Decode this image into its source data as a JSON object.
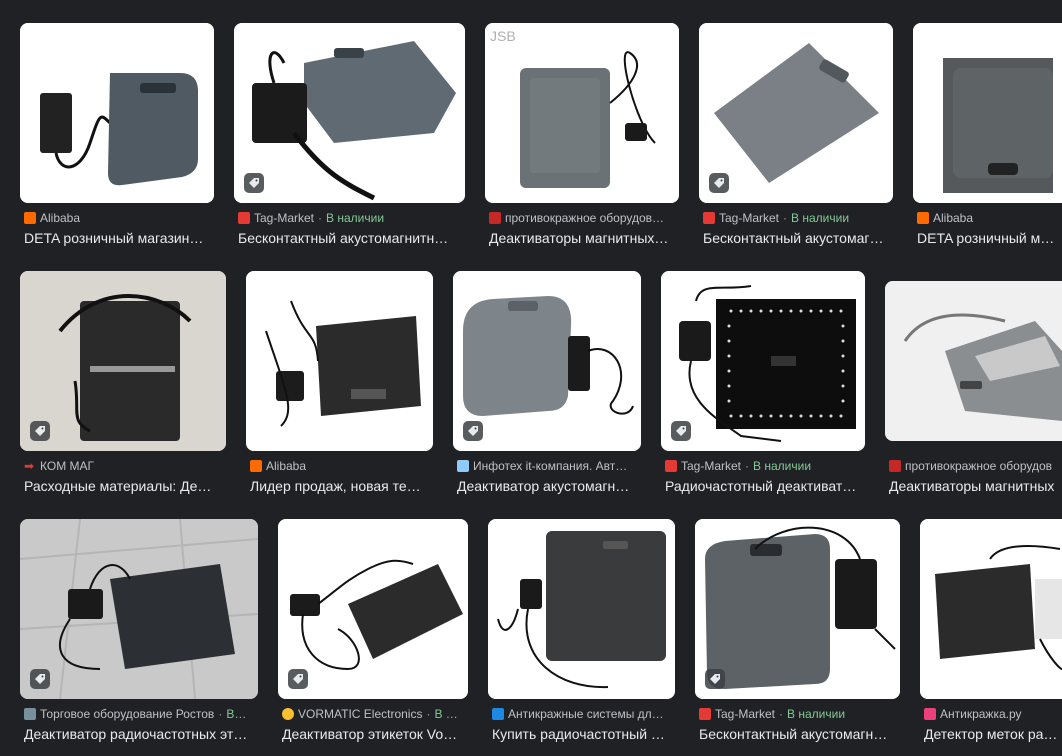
{
  "results": [
    {
      "source": "Alibaba",
      "stock": "",
      "title": "DETA розничный магазин…",
      "fav_color": "#ff6a00",
      "shopping": false
    },
    {
      "source": "Tag-Market",
      "stock": "В наличии",
      "title": "Бесконтактный акустомагнитн…",
      "fav_color": "#e53935",
      "shopping": true
    },
    {
      "source": "противокражное оборудов…",
      "stock": "",
      "title": "Деактиваторы магнитных…",
      "fav_color": "#c62828",
      "shopping": false
    },
    {
      "source": "Tag-Market",
      "stock": "В наличии",
      "title": "Бесконтактный акустомаг…",
      "fav_color": "#e53935",
      "shopping": true
    },
    {
      "source": "Alibaba",
      "stock": "",
      "title": "DETA розничный магаз",
      "fav_color": "#ff6a00",
      "shopping": false
    },
    {
      "source": "КОМ МАГ",
      "stock": "",
      "title": "Расходные материалы: Де…",
      "fav_color": "#d32f2f",
      "shopping": true
    },
    {
      "source": "Alibaba",
      "stock": "",
      "title": "Лидер продаж, новая те…",
      "fav_color": "#ff6a00",
      "shopping": false
    },
    {
      "source": "Инфотех it-компания. Авт…",
      "stock": "",
      "title": "Деактиватор акустомагн…",
      "fav_color": "#90caf9",
      "shopping": true
    },
    {
      "source": "Tag-Market",
      "stock": "В наличии",
      "title": "Радиочастотный деактиват…",
      "fav_color": "#e53935",
      "shopping": true
    },
    {
      "source": "противокражное оборудов",
      "stock": "",
      "title": "Деактиваторы магнитных",
      "fav_color": "#c62828",
      "shopping": false
    },
    {
      "source": "Торговое оборудование Ростов",
      "stock": "В…",
      "title": "Деактиватор радиочастотных эт…",
      "fav_color": "#78909c",
      "shopping": true
    },
    {
      "source": "VORMATIC Electronics",
      "stock": "В …",
      "title": "Деактиватор этикеток Vo…",
      "fav_color": "#fbc02d",
      "shopping": true
    },
    {
      "source": "Антикражные системы дл…",
      "stock": "",
      "title": "Купить радиочастотный …",
      "fav_color": "#1e88e5",
      "shopping": false
    },
    {
      "source": "Tag-Market",
      "stock": "В наличии",
      "title": "Бесконтактный акустомагн…",
      "fav_color": "#e53935",
      "shopping": true
    },
    {
      "source": "Антикражка.ру",
      "stock": "",
      "title": "Детектор меток ради",
      "fav_color": "#ec407a",
      "shopping": false
    }
  ]
}
